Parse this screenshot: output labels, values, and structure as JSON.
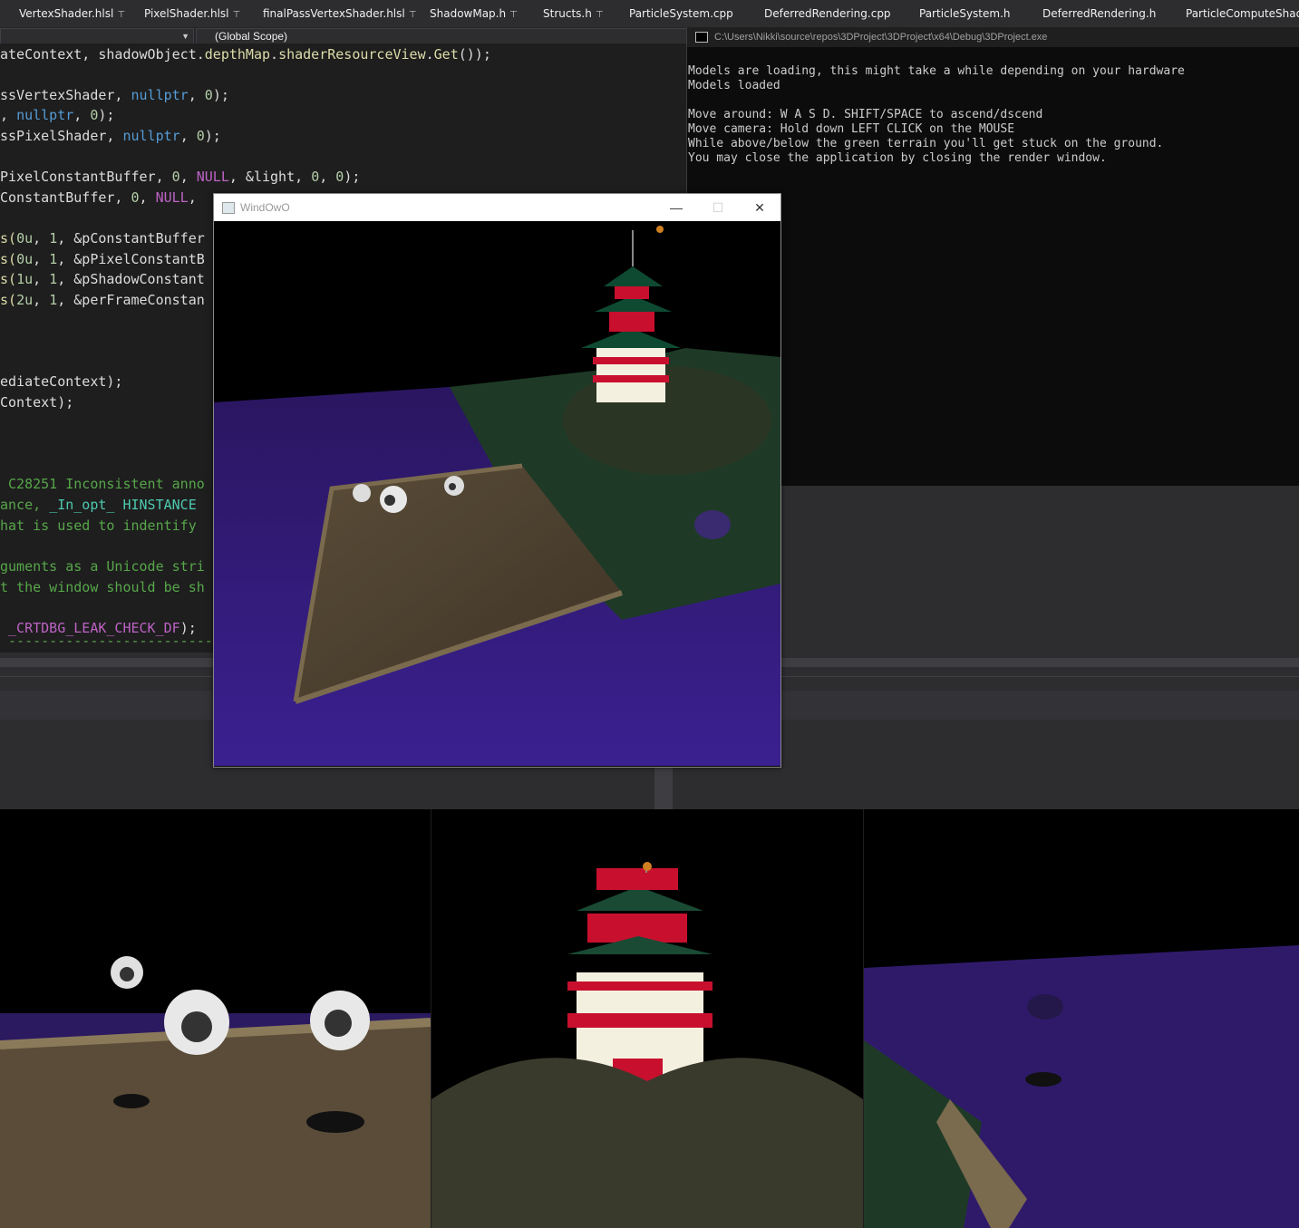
{
  "tabs": [
    {
      "label": "VertexShader.hlsl",
      "pinned": true
    },
    {
      "label": "PixelShader.hlsl",
      "pinned": true
    },
    {
      "label": "finalPassVertexShader.hlsl",
      "pinned": true
    },
    {
      "label": "ShadowMap.h",
      "pinned": true
    },
    {
      "label": "Structs.h",
      "pinned": true
    },
    {
      "label": "ParticleSystem.cpp",
      "pinned": false
    },
    {
      "label": "DeferredRendering.cpp",
      "pinned": false
    },
    {
      "label": "ParticleSystem.h",
      "pinned": false
    },
    {
      "label": "DeferredRendering.h",
      "pinned": false
    },
    {
      "label": "ParticleComputeShader",
      "pinned": false
    }
  ],
  "scope_dropdown": "(Global Scope)",
  "code": {
    "l1a": "ateContext, shadowObject.",
    "l1b": "depthMap",
    "l1c": ".",
    "l1d": "shaderResourceView",
    "l1e": ".",
    "l1f": "Get",
    "l1g": "());",
    "l2a": "ssVertexShader, ",
    "l2b": "nullptr",
    "l2c": ", ",
    "l2d": "0",
    "l2e": ");",
    "l3a": ", ",
    "l3b": "nullptr",
    "l3c": ", ",
    "l3d": "0",
    "l3e": ");",
    "l4a": "ssPixelShader, ",
    "l4b": "nullptr",
    "l4c": ", ",
    "l4d": "0",
    "l4e": ");",
    "l5a": "PixelConstantBuffer, ",
    "l5b": "0",
    "l5c": ", ",
    "l5d": "NULL",
    "l5e": ", &light, ",
    "l5f": "0",
    "l5g": ", ",
    "l5h": "0",
    "l5i": ");",
    "l6a": "ConstantBuffer, ",
    "l6b": "0",
    "l6c": ", ",
    "l6d": "NULL",
    "l6e": ",",
    "l7a": "s(",
    "l7b": "0u",
    "l7c": ", ",
    "l7d": "1",
    "l7e": ", &pConstantBuffer",
    "l8a": "s(",
    "l8b": "0u",
    "l8c": ", ",
    "l8d": "1",
    "l8e": ", &pPixelConstantB",
    "l9a": "s(",
    "l9b": "1u",
    "l9c": ", ",
    "l9d": "1",
    "l9e": ", &pShadowConstant",
    "l10a": "s(",
    "l10b": "2u",
    "l10c": ", ",
    "l10d": "1",
    "l10e": ", &perFrameConstan",
    "l11": "ediateContext);",
    "l12": "Context);",
    "l13": " C28251 Inconsistent anno",
    "l14a": "ance, ",
    "l14b": "_In_opt_",
    "l14c": " ",
    "l14d": "HINSTANCE",
    "l15": "hat is used to indentify",
    "l16": "guments as a Unicode stri",
    "l17": "t the window should be sh",
    "l18a": " ",
    "l18b": "_CRTDBG_LEAK_CHECK_DF",
    "l18c": ");",
    "l19": " ----------------------------------"
  },
  "console": {
    "title": "C:\\Users\\Nikki\\source\\repos\\3DProject\\3DProject\\x64\\Debug\\3DProject.exe",
    "lines": [
      "Models are loading, this might take a while depending on your hardware",
      "Models loaded",
      "",
      "Move around: W A S D. SHIFT/SPACE to ascend/dscend",
      "Move camera: Hold down LEFT CLICK on the MOUSE",
      "While above/below the green terrain you'll get stuck on the ground.",
      "You may close the application by closing the render window."
    ]
  },
  "render_window": {
    "title": "WindOwO",
    "minimize": "—",
    "maximize": "☐",
    "close": "✕"
  },
  "colors": {
    "water": "#2a1660",
    "terrain": "#1e3a26",
    "wood": "#5a4a34",
    "pagoda_red": "#c8102e",
    "pagoda_green": "#0e4a32"
  }
}
